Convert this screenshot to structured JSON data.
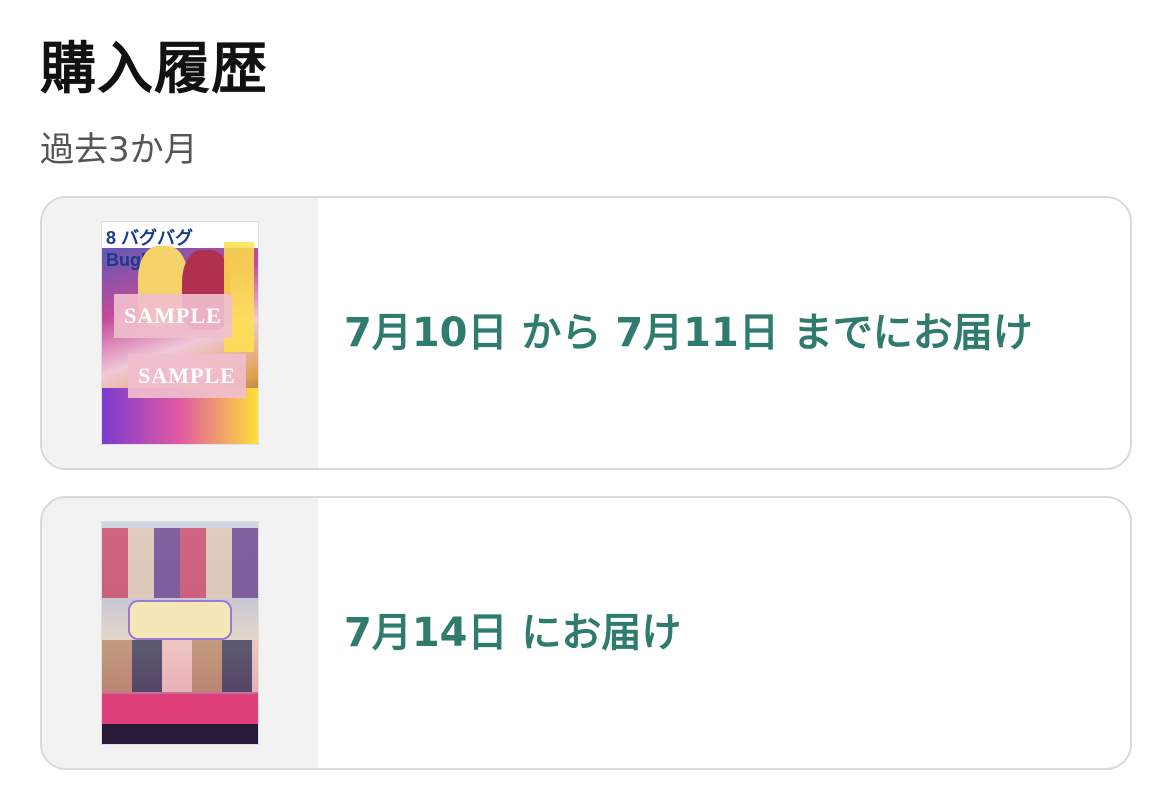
{
  "header": {
    "title": "購入履歴",
    "subtitle": "過去3か月"
  },
  "orders": [
    {
      "delivery_text": "7月10日 から 7月11日 までにお届け",
      "cover": {
        "masthead": "8 バグバグ BugBug",
        "sample_labels": [
          "SAMPLE",
          "SAMPLE"
        ]
      }
    },
    {
      "delivery_text": "7月14日 にお届け",
      "cover": {}
    }
  ]
}
